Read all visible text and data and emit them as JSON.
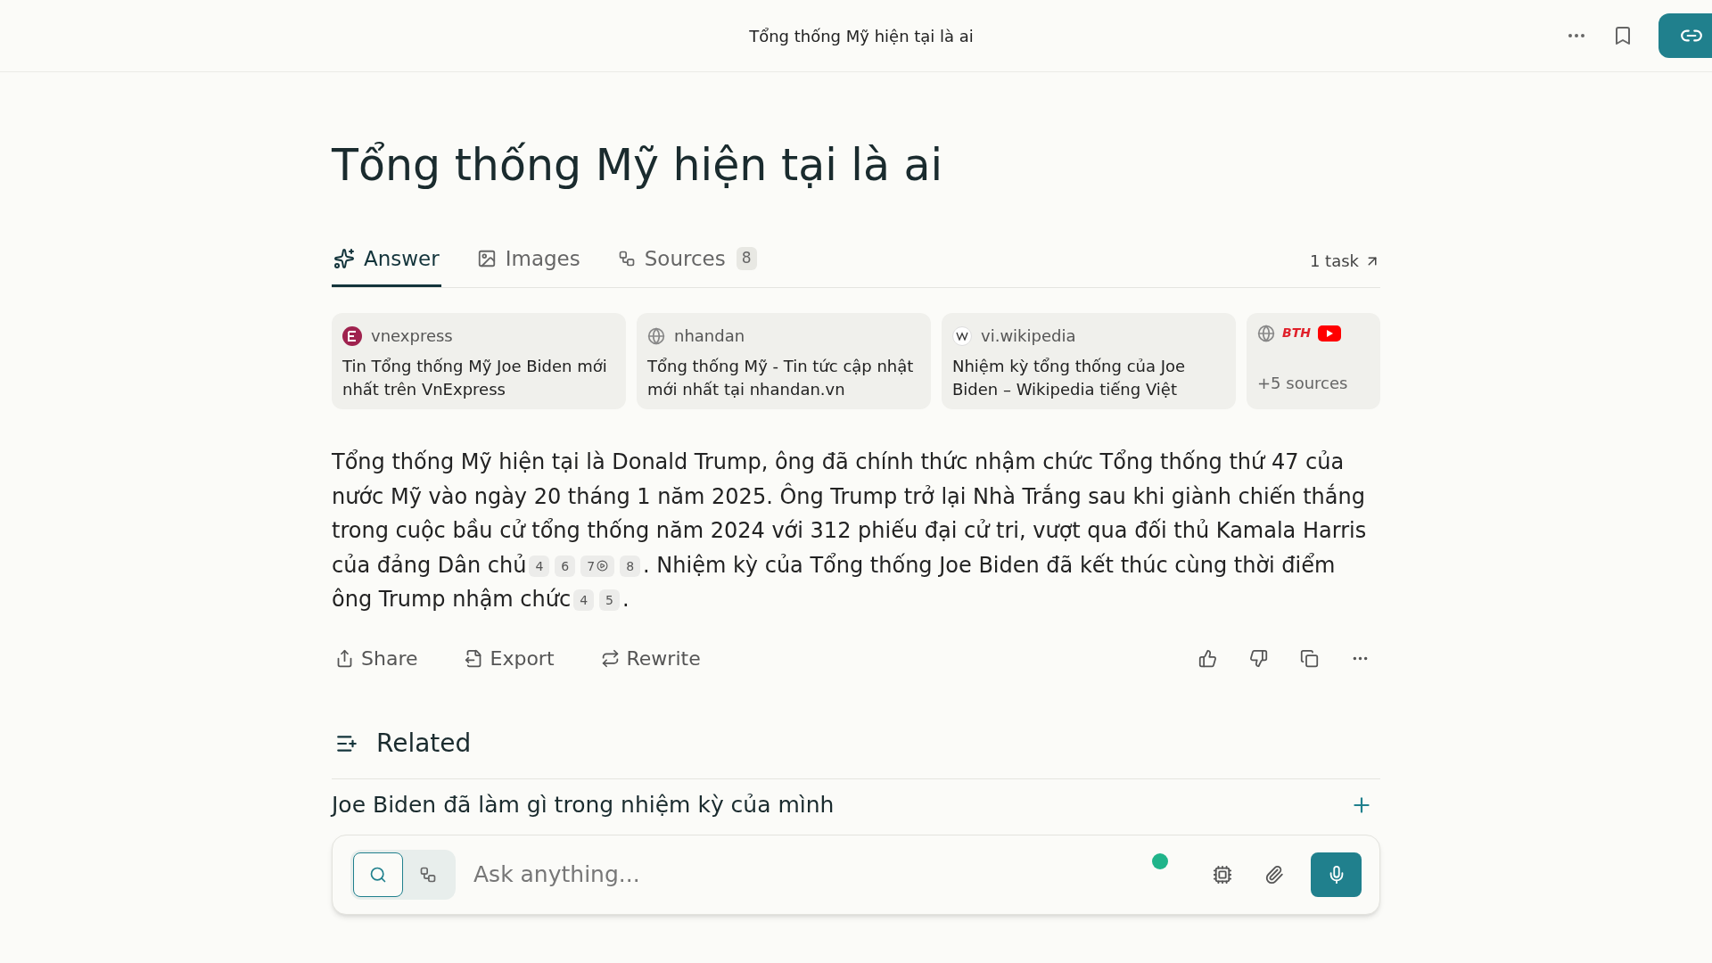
{
  "header": {
    "title": "Tổng thống Mỹ hiện tại là ai"
  },
  "query": "Tổng thống Mỹ hiện tại là ai",
  "tabs": [
    {
      "label": "Answer",
      "kind": "answer",
      "selected": true
    },
    {
      "label": "Images",
      "kind": "images",
      "selected": false
    },
    {
      "label": "Sources",
      "kind": "sources",
      "selected": false,
      "count": "8"
    }
  ],
  "task_link": "1 task",
  "sources": [
    {
      "kind": "site",
      "site": "vnexpress",
      "title": "Tin Tổng thống Mỹ Joe Biden mới nhất trên VnExpress"
    },
    {
      "kind": "site",
      "site": "nhandan",
      "title": "Tổng thống Mỹ - Tin tức cập nhật mới nhất tại nhandan.vn"
    },
    {
      "kind": "site",
      "site": "vi.wikipedia",
      "title": "Nhiệm kỳ tổng thống của Joe Biden – Wikipedia tiếng Việt"
    },
    {
      "kind": "more",
      "label": "+5 sources",
      "brand": "BTH"
    }
  ],
  "answer": [
    {
      "kind": "text",
      "text": "Tổng thống Mỹ hiện tại là Donald Trump, ông đã chính thức nhậm chức Tổng thống thứ 47 của nước Mỹ vào ngày 20 tháng 1 năm 2025. Ông Trump trở lại Nhà Trắng sau khi giành chiến thắng trong cuộc bầu cử tổng thống năm 2024 với 312 phiếu đại cử tri, vượt qua đối thủ Kamala Harris của đảng Dân chủ"
    },
    {
      "kind": "cite",
      "label": "4",
      "video": false
    },
    {
      "kind": "cite",
      "label": "6",
      "video": false
    },
    {
      "kind": "cite",
      "label": "7",
      "video": true
    },
    {
      "kind": "cite",
      "label": "8",
      "video": false
    },
    {
      "kind": "text",
      "text": ". Nhiệm kỳ của Tổng thống Joe Biden đã kết thúc cùng thời điểm ông Trump nhậm chức"
    },
    {
      "kind": "cite",
      "label": "4",
      "video": false
    },
    {
      "kind": "cite",
      "label": "5",
      "video": false
    },
    {
      "kind": "text",
      "text": "."
    }
  ],
  "actions": [
    {
      "kind": "share",
      "label": "Share"
    },
    {
      "kind": "export",
      "label": "Export"
    },
    {
      "kind": "rewrite",
      "label": "Rewrite"
    }
  ],
  "related": {
    "title": "Related",
    "items": [
      "Joe Biden đã làm gì trong nhiệm kỳ của mình"
    ]
  },
  "composer": {
    "placeholder": "Ask anything...",
    "modes": [
      {
        "kind": "search",
        "selected": true
      },
      {
        "kind": "reason",
        "selected": false
      }
    ]
  }
}
